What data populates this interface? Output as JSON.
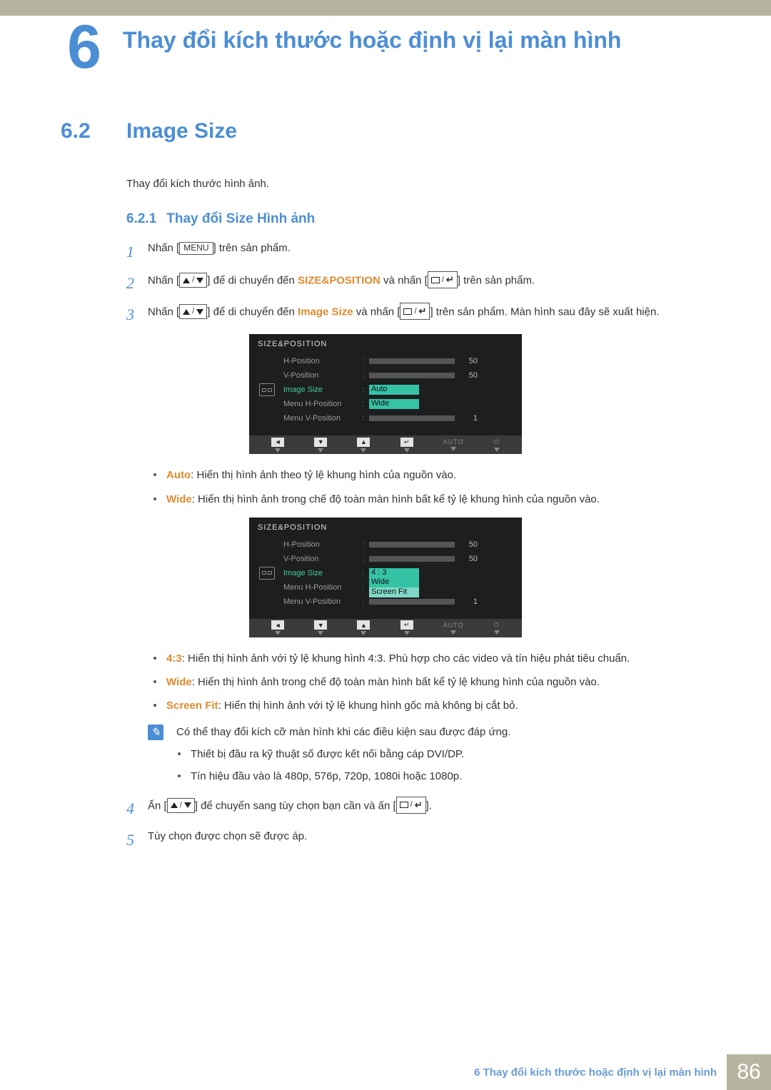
{
  "chapter": {
    "num": "6",
    "title": "Thay đổi kích thước hoặc định vị lại màn hình"
  },
  "section": {
    "num": "6.2",
    "title": "Image Size"
  },
  "intro": "Thay đổi kích thước hình ảnh.",
  "subsection": {
    "num": "6.2.1",
    "title": "Thay đổi Size Hình ảnh"
  },
  "steps": {
    "s1": {
      "n": "1",
      "a": "Nhấn [",
      "menu": "MENU",
      "b": "] trên sản phẩm."
    },
    "s2": {
      "n": "2",
      "a": "Nhấn [",
      "b": "] để di chuyển đến ",
      "kw": "SIZE&POSITION",
      "c": " và nhấn [",
      "d": "] trên sản phẩm."
    },
    "s3": {
      "n": "3",
      "a": "Nhấn [",
      "b": "] để di chuyển đến ",
      "kw": "Image Size",
      "c": " và nhấn [",
      "d": "] trên sản phẩm. Màn hình sau đây sẽ xuất hiện."
    },
    "s4": {
      "n": "4",
      "a": "Ấn [",
      "b": "] để chuyển sang tùy chọn bạn cần và ấn [",
      "c": "]."
    },
    "s5": {
      "n": "5",
      "t": "Tùy chọn được chọn sẽ được áp."
    }
  },
  "bullets1": {
    "b1": {
      "term": "Auto",
      "t": ": Hiển thị hình ảnh theo tỷ lệ khung hình của nguồn vào."
    },
    "b2": {
      "term": "Wide",
      "t": ": Hiển thị hình ảnh trong chế độ toàn màn hình bất kể tỷ lệ khung hình của nguồn vào."
    }
  },
  "bullets2": {
    "b1": {
      "term": "4:3",
      "t": ": Hiển thị hình ảnh với tỷ lệ khung hình 4:3. Phù hợp cho các video và tín hiệu phát tiêu chuẩn."
    },
    "b2": {
      "term": "Wide",
      "t": ": Hiển thị hình ảnh trong chế độ toàn màn hình bất kể tỷ lệ khung hình của nguồn vào."
    },
    "b3": {
      "term": "Screen Fit",
      "t": ": Hiển thị hình ảnh với tỷ lệ khung hình gốc mà không bị cắt bỏ."
    }
  },
  "note": {
    "t": "Có thể thay đổi kích cỡ màn hình khi các điều kiện sau được đáp ứng.",
    "n1": "Thiết bị đầu ra kỹ thuật số được kết nối bằng cáp DVI/DP.",
    "n2": "Tín hiệu đầu vào là 480p, 576p, 720p, 1080i hoặc 1080p."
  },
  "osd": {
    "title": "SIZE&POSITION",
    "rows": {
      "r1": {
        "label": "H-Position",
        "val": "50",
        "fill": 50
      },
      "r2": {
        "label": "V-Position",
        "val": "50",
        "fill": 50
      },
      "r3": {
        "label": "Image Size"
      },
      "r4": {
        "label": "Menu H-Position"
      },
      "r5": {
        "label": "Menu V-Position",
        "val": "1"
      }
    },
    "opts1": {
      "o1": "Auto",
      "o2": "Wide"
    },
    "opts2": {
      "o1": "4 : 3",
      "o2": "Wide",
      "o3": "Screen Fit"
    },
    "auto_btn": "AUTO"
  },
  "footer": {
    "txt": "6 Thay đổi kích thước hoặc định vị lại màn hình",
    "page": "86"
  }
}
